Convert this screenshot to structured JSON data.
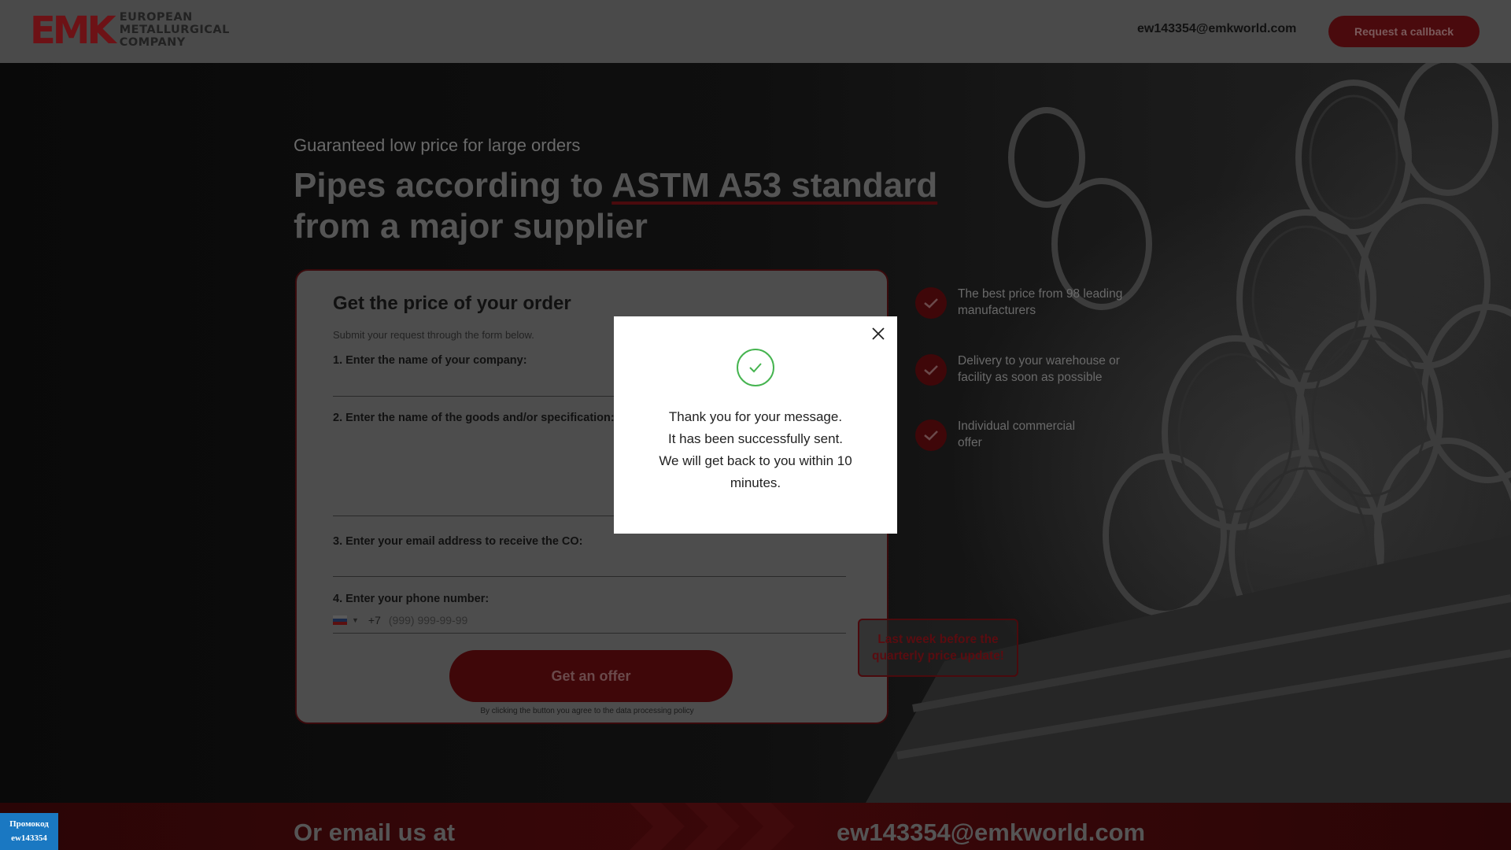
{
  "header": {
    "logo_mark": "EMK",
    "logo_lines": [
      "EUROPEAN",
      "METALLURGICAL",
      "COMPANY"
    ],
    "email": "ew143354@emkworld.com",
    "callback_label": "Request a callback"
  },
  "hero": {
    "subtitle": "Guaranteed low price for large orders",
    "title_part1": "Pipes according to ",
    "title_highlight": "ASTM A53 standard",
    "title_part2": "from a major supplier"
  },
  "form": {
    "heading": "Get the price of your order",
    "hint": "Submit your request through the form below.",
    "label_company": "1. Enter the name of your company:",
    "label_goods": "2. Enter the name of the goods and/or specification:",
    "label_email": "3. Enter your email address to receive the CO:",
    "label_phone": "4. Enter your phone number:",
    "phone_prefix": "+7",
    "phone_placeholder": "(999) 999-99-99",
    "submit_label": "Get an offer",
    "policy": "By clicking the button you agree to the data processing policy"
  },
  "benefits": [
    {
      "text": "The best price from 98 leading manufacturers",
      "icon": "check-icon"
    },
    {
      "text": "Delivery to your warehouse or facility as soon as possible",
      "icon": "check-icon"
    },
    {
      "text": "Individual commercial offer",
      "icon": "check-icon"
    }
  ],
  "urgent_note": "Last week before the quarterly price update!",
  "footer": {
    "left": "Or email us at",
    "right": "ew143354@emkworld.com"
  },
  "promo": {
    "line1": "Промокод",
    "line2": "ew143354"
  },
  "modal": {
    "line1": "Thank you for your message.",
    "line2": "It has been successfully sent.",
    "line3": "We will get back to you within 10 minutes.",
    "icon": "success-check-icon",
    "close_icon": "close-icon"
  },
  "colors": {
    "accent": "#c0121a",
    "success": "#46b450",
    "promo": "#1a78c2"
  }
}
